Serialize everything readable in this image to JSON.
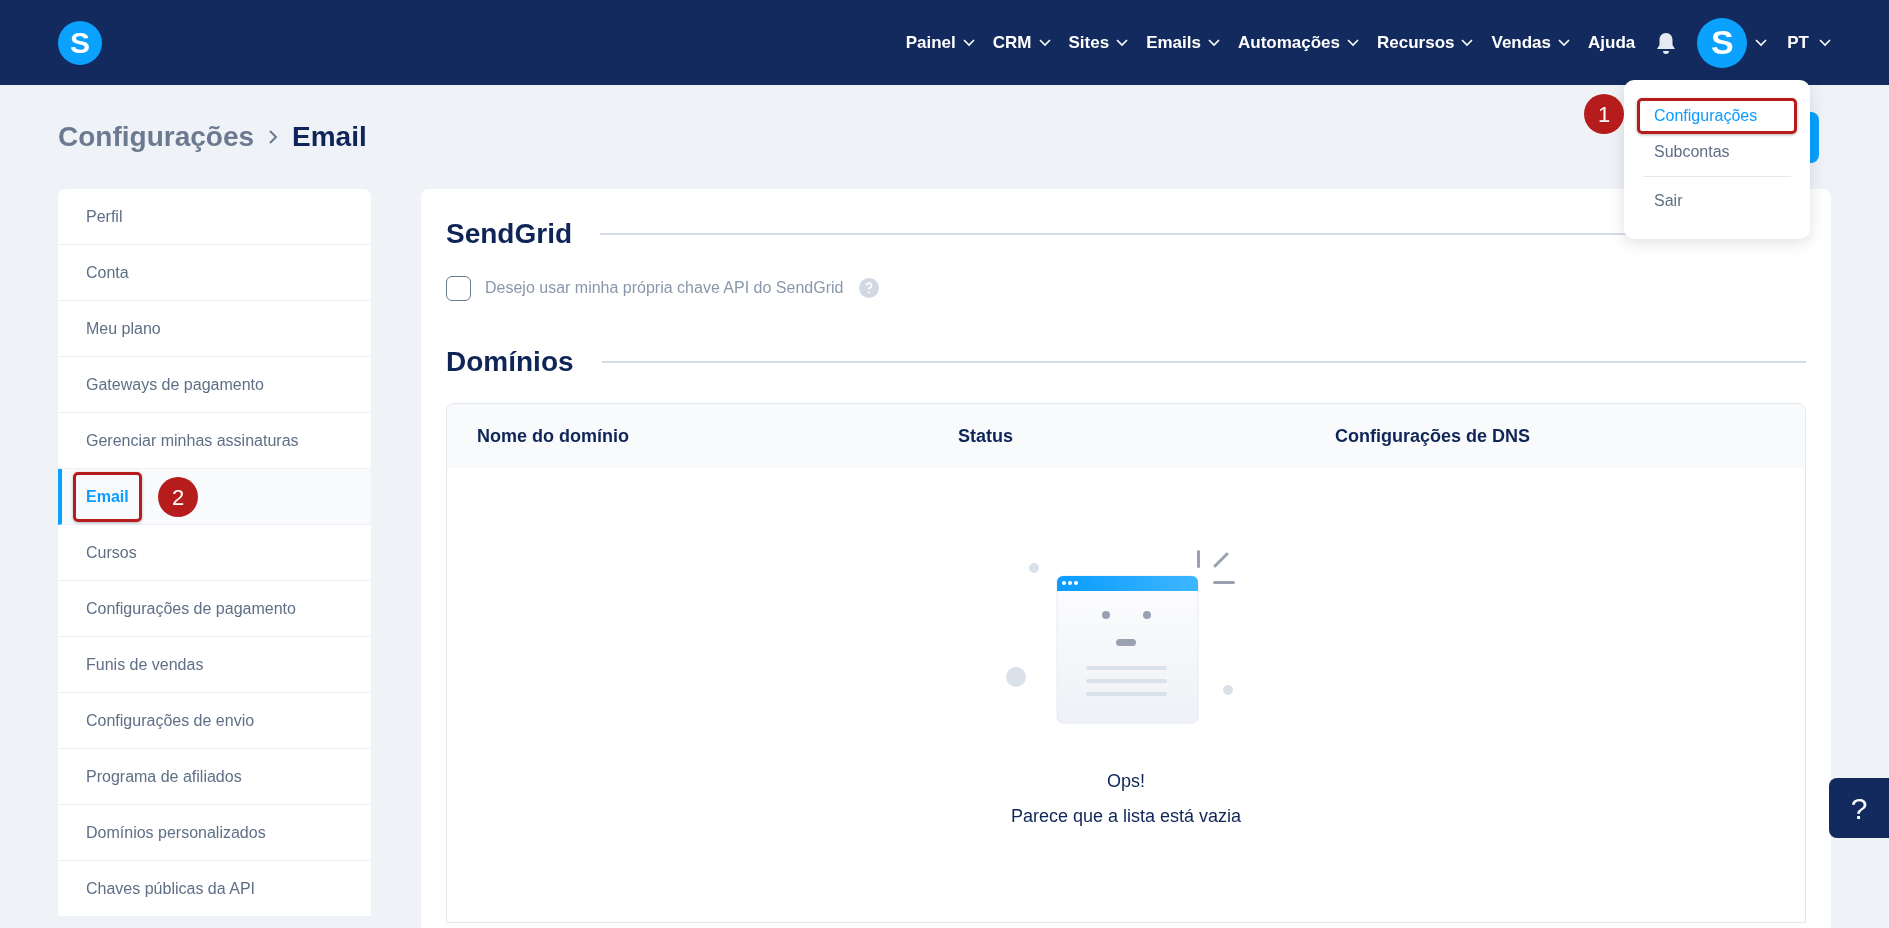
{
  "topbar": {
    "logo": "S",
    "nav": [
      {
        "label": "Painel",
        "dropdown": true
      },
      {
        "label": "CRM",
        "dropdown": true
      },
      {
        "label": "Sites",
        "dropdown": true
      },
      {
        "label": "Emails",
        "dropdown": true
      },
      {
        "label": "Automações",
        "dropdown": true
      },
      {
        "label": "Recursos",
        "dropdown": true
      },
      {
        "label": "Vendas",
        "dropdown": true
      },
      {
        "label": "Ajuda",
        "dropdown": false
      }
    ],
    "avatar": "S",
    "language": "PT"
  },
  "user_menu": {
    "items": [
      {
        "label": "Configurações",
        "selected": true,
        "highlighted": true,
        "callout": "1"
      },
      {
        "label": "Subcontas",
        "selected": false,
        "highlighted": false
      },
      {
        "label": "Sair",
        "selected": false,
        "highlighted": false
      }
    ]
  },
  "breadcrumb": [
    "Configurações",
    "Email"
  ],
  "sidebar": {
    "items": [
      {
        "label": "Perfil",
        "selected": false,
        "highlighted": false
      },
      {
        "label": "Conta",
        "selected": false,
        "highlighted": false
      },
      {
        "label": "Meu plano",
        "selected": false,
        "highlighted": false
      },
      {
        "label": "Gateways de pagamento",
        "selected": false,
        "highlighted": false
      },
      {
        "label": "Gerenciar minhas assinaturas",
        "selected": false,
        "highlighted": false
      },
      {
        "label": "Email",
        "selected": true,
        "highlighted": true,
        "callout": "2"
      },
      {
        "label": "Cursos",
        "selected": false,
        "highlighted": false
      },
      {
        "label": "Configurações de pagamento",
        "selected": false,
        "highlighted": false
      },
      {
        "label": "Funis de vendas",
        "selected": false,
        "highlighted": false
      },
      {
        "label": "Configurações de envio",
        "selected": false,
        "highlighted": false
      },
      {
        "label": "Programa de afiliados",
        "selected": false,
        "highlighted": false
      },
      {
        "label": "Domínios personalizados",
        "selected": false,
        "highlighted": false
      },
      {
        "label": "Chaves públicas da API",
        "selected": false,
        "highlighted": false
      }
    ]
  },
  "sendgrid": {
    "title": "SendGrid",
    "checkbox": {
      "label": "Desejo usar minha própria chave API do SendGrid",
      "checked": false
    }
  },
  "domains": {
    "title": "Domínios",
    "columns": [
      "Nome do domínio",
      "Status",
      "Configurações de DNS"
    ],
    "empty_title": "Ops!",
    "empty_text": "Parece que a lista está vazia"
  },
  "help_button": "?"
}
